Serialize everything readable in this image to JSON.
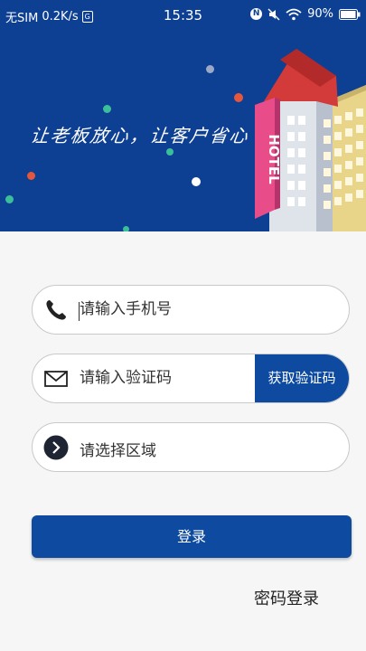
{
  "status_bar": {
    "carrier": "无SIM",
    "speed": "0.2K/s",
    "time": "15:35",
    "battery": "90%"
  },
  "banner": {
    "slogan": "让老板放心，让客户省心",
    "hotel_sign": "HOTEL"
  },
  "form": {
    "phone_placeholder": "请输入手机号",
    "code_placeholder": "请输入验证码",
    "get_code_label": "获取验证码",
    "region_label": "请选择区域"
  },
  "login_label": "登录",
  "password_login_label": "密码登录",
  "colors": {
    "banner_bg": "#0d3f93",
    "primary": "#0d4aa0",
    "page_bg": "#f6f6f6"
  },
  "icons": {
    "phone": "phone-icon",
    "mail": "mail-icon",
    "region": "chevron-right-circle-icon"
  }
}
